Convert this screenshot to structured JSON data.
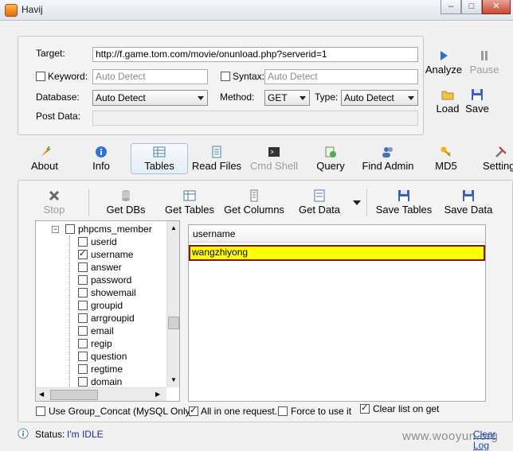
{
  "window": {
    "title": "Havij"
  },
  "target": {
    "label": "Target:",
    "value": "http://f.game.tom.com/movie/onunload.php?serverid=1"
  },
  "keyword": {
    "label": "Keyword:",
    "placeholder": "Auto Detect",
    "checked": false
  },
  "syntax": {
    "label": "Syntax:",
    "placeholder": "Auto Detect",
    "checked": false
  },
  "database": {
    "label": "Database:",
    "selected": "Auto Detect"
  },
  "method": {
    "label": "Method:",
    "selected": "GET"
  },
  "type": {
    "label": "Type:",
    "selected": "Auto Detect"
  },
  "postdata": {
    "label": "Post Data:",
    "value": ""
  },
  "actions": {
    "analyze": "Analyze",
    "pause": "Pause",
    "load": "Load",
    "save": "Save"
  },
  "tabs": [
    {
      "label": "About",
      "icon": "carrot-icon"
    },
    {
      "label": "Info",
      "icon": "info-icon"
    },
    {
      "label": "Tables",
      "icon": "table-icon",
      "selected": true
    },
    {
      "label": "Read Files",
      "icon": "document-icon"
    },
    {
      "label": "Cmd Shell",
      "icon": "terminal-icon",
      "disabled": true
    },
    {
      "label": "Query",
      "icon": "query-icon"
    },
    {
      "label": "Find Admin",
      "icon": "users-icon"
    },
    {
      "label": "MD5",
      "icon": "key-icon"
    },
    {
      "label": "Settings",
      "icon": "tools-icon"
    }
  ],
  "tables_toolbar": {
    "stop": "Stop",
    "get_dbs": "Get DBs",
    "get_tables": "Get Tables",
    "get_columns": "Get Columns",
    "get_data": "Get Data",
    "save_tables": "Save Tables",
    "save_data": "Save Data"
  },
  "tree": {
    "table": "phpcms_member",
    "columns": [
      {
        "name": "userid",
        "checked": false
      },
      {
        "name": "username",
        "checked": true
      },
      {
        "name": "answer",
        "checked": false
      },
      {
        "name": "password",
        "checked": false
      },
      {
        "name": "showemail",
        "checked": false
      },
      {
        "name": "groupid",
        "checked": false
      },
      {
        "name": "arrgroupid",
        "checked": false
      },
      {
        "name": "email",
        "checked": false
      },
      {
        "name": "regip",
        "checked": false
      },
      {
        "name": "question",
        "checked": false
      },
      {
        "name": "regtime",
        "checked": false
      },
      {
        "name": "domain",
        "checked": false
      }
    ]
  },
  "results": {
    "column_header": "username",
    "rows": [
      "wangzhiyong"
    ]
  },
  "options": {
    "group_concat": {
      "label": "Use Group_Concat (MySQL Only)",
      "checked": false
    },
    "all_in_one": {
      "label": "All in one request.",
      "checked": true
    },
    "force": {
      "label": "Force to use it",
      "checked": false
    },
    "clear_list": {
      "label": "Clear list on get",
      "checked": true
    }
  },
  "status": {
    "label": "Status:",
    "value": "I'm IDLE",
    "clear_log": "Clear Log"
  },
  "watermark": "www.wooyun.org",
  "colors": {
    "highlight": "#ffff00",
    "highlight_border": "#7a1a1a",
    "status_text": "#1a2a9a"
  }
}
